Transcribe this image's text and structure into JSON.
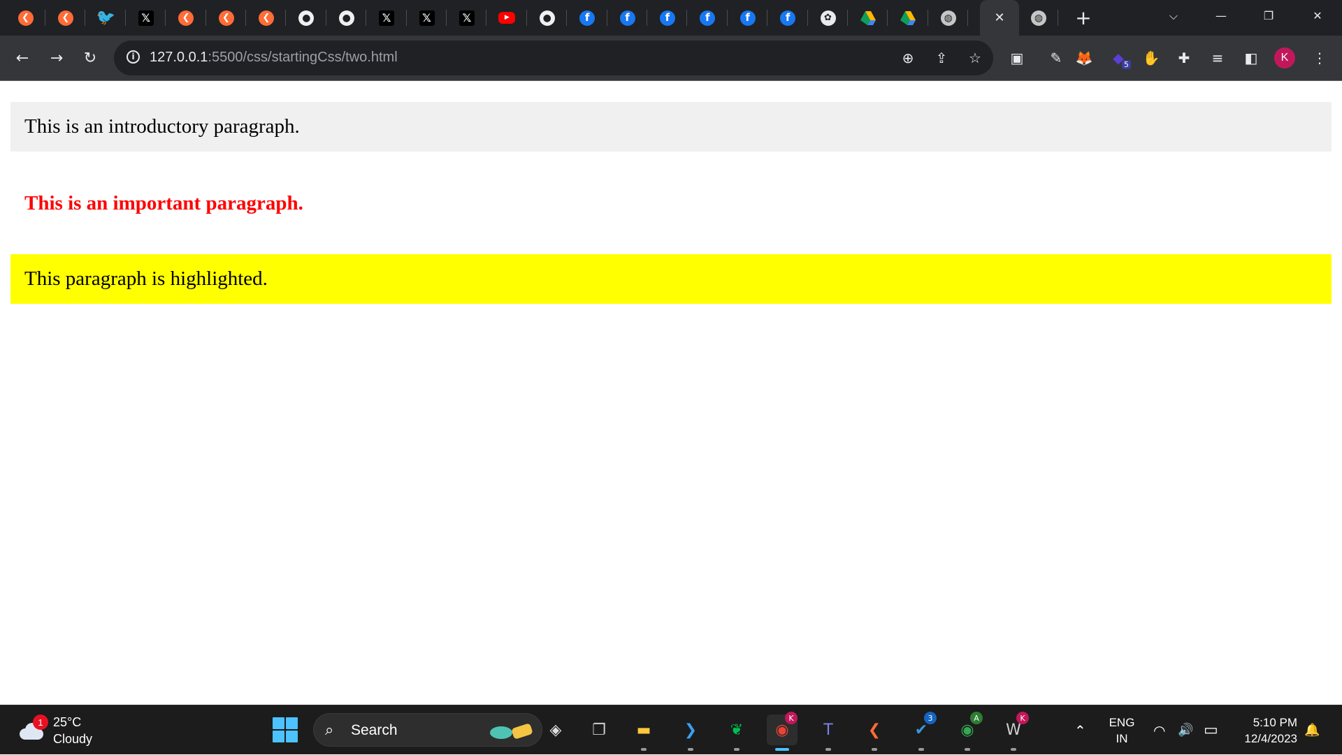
{
  "browser": {
    "tabs": [
      {
        "icon": "postman-icon",
        "cls": "postman",
        "glyph": "❮"
      },
      {
        "icon": "postman-icon",
        "cls": "postman",
        "glyph": "❮"
      },
      {
        "icon": "twitter-bird-icon",
        "cls": "twitter",
        "glyph": "🐦"
      },
      {
        "icon": "x-logo-icon",
        "cls": "x",
        "glyph": "𝕏"
      },
      {
        "icon": "postman-icon",
        "cls": "postman",
        "glyph": "❮"
      },
      {
        "icon": "postman-icon",
        "cls": "postman",
        "glyph": "❮"
      },
      {
        "icon": "postman-icon",
        "cls": "postman",
        "glyph": "❮"
      },
      {
        "icon": "github-icon",
        "cls": "github",
        "glyph": "●"
      },
      {
        "icon": "github-icon",
        "cls": "github",
        "glyph": "●"
      },
      {
        "icon": "x-logo-icon",
        "cls": "x",
        "glyph": "𝕏"
      },
      {
        "icon": "x-logo-icon",
        "cls": "x",
        "glyph": "𝕏"
      },
      {
        "icon": "x-logo-icon",
        "cls": "x",
        "glyph": "𝕏"
      },
      {
        "icon": "youtube-icon",
        "cls": "youtube",
        "glyph": "▶"
      },
      {
        "icon": "github-icon",
        "cls": "github",
        "glyph": "●"
      },
      {
        "icon": "facebook-icon",
        "cls": "facebook",
        "glyph": "f"
      },
      {
        "icon": "facebook-icon",
        "cls": "facebook",
        "glyph": "f"
      },
      {
        "icon": "facebook-icon",
        "cls": "facebook",
        "glyph": "f"
      },
      {
        "icon": "facebook-icon",
        "cls": "facebook",
        "glyph": "f"
      },
      {
        "icon": "facebook-icon",
        "cls": "facebook",
        "glyph": "f"
      },
      {
        "icon": "facebook-icon",
        "cls": "facebook",
        "glyph": "f"
      },
      {
        "icon": "chatgpt-icon",
        "cls": "chromeish",
        "glyph": "✿"
      },
      {
        "icon": "google-drive-icon",
        "cls": "drive",
        "glyph": ""
      },
      {
        "icon": "google-drive-icon",
        "cls": "drive",
        "glyph": ""
      },
      {
        "icon": "globe-icon",
        "cls": "globe",
        "glyph": "◍"
      }
    ],
    "active_tab": {
      "close_glyph": "✕"
    },
    "after_tab": {
      "icon": "globe-icon",
      "glyph": "◍"
    },
    "new_tab_glyph": "+",
    "window_controls": {
      "tab_search": "⌵",
      "minimize": "—",
      "restore": "❐",
      "close": "✕"
    },
    "nav": {
      "back": "←",
      "forward": "→",
      "reload": "↻"
    },
    "address": {
      "host": "127.0.0.1",
      "rest": ":5500/css/startingCss/two.html",
      "info_glyph": "i",
      "zoom_glyph": "⊕",
      "share_glyph": "⇪",
      "bookmark_glyph": "☆"
    },
    "extensions": {
      "pip_glyph": "▣",
      "pen_glyph": "✎",
      "metamask_glyph": "🦊",
      "stack_glyph": "◆",
      "stack_badge": "5",
      "adblock_glyph": "✋",
      "puzzle_glyph": "✚",
      "media_glyph": "≡",
      "sidepanel_glyph": "◧",
      "menu_glyph": "⋮"
    },
    "profile_initial": "K"
  },
  "page": {
    "intro": "This is an introductory paragraph.",
    "important": "This is an important paragraph.",
    "highlighted": "This paragraph is highlighted."
  },
  "taskbar": {
    "weather": {
      "badge": "1",
      "temp": "25°C",
      "condition": "Cloudy"
    },
    "search_label": "Search",
    "apps": [
      {
        "name": "copilot-icon",
        "glyph": "◈",
        "color": "#e0e0e0",
        "badge": "",
        "badge_color": "",
        "dot": false,
        "active": false
      },
      {
        "name": "task-view-icon",
        "glyph": "❐",
        "color": "#cfcfcf",
        "badge": "",
        "badge_color": "",
        "dot": false,
        "active": false
      },
      {
        "name": "file-explorer-icon",
        "glyph": "▬",
        "color": "#ffc83d",
        "badge": "",
        "badge_color": "",
        "dot": true,
        "active": false
      },
      {
        "name": "vscode-icon",
        "glyph": "❯",
        "color": "#3aa0f3",
        "badge": "",
        "badge_color": "",
        "dot": true,
        "active": false
      },
      {
        "name": "mongodb-compass-icon",
        "glyph": "❦",
        "color": "#00c050",
        "badge": "",
        "badge_color": "",
        "dot": true,
        "active": false
      },
      {
        "name": "chrome-icon",
        "glyph": "◉",
        "color": "#ea4335",
        "badge": "K",
        "badge_color": "#c2185b",
        "dot": true,
        "active": true
      },
      {
        "name": "teams-icon",
        "glyph": "T",
        "color": "#7b83eb",
        "badge": "",
        "badge_color": "",
        "dot": true,
        "active": false
      },
      {
        "name": "postman-icon",
        "glyph": "❮",
        "color": "#ff6c37",
        "badge": "",
        "badge_color": "",
        "dot": true,
        "active": false
      },
      {
        "name": "todo-icon",
        "glyph": "✔",
        "color": "#3a96dd",
        "badge": "3",
        "badge_color": "#1565c0",
        "dot": true,
        "active": false
      },
      {
        "name": "chrome-icon",
        "glyph": "◉",
        "color": "#34a853",
        "badge": "A",
        "badge_color": "#2e7d32",
        "dot": true,
        "active": false
      },
      {
        "name": "wordpad-icon",
        "glyph": "W",
        "color": "#d0d0d0",
        "badge": "K",
        "badge_color": "#c2185b",
        "dot": true,
        "active": false
      }
    ],
    "tray": {
      "chevron": "⌃",
      "lang_top": "ENG",
      "lang_bottom": "IN",
      "wifi": "◠",
      "volume": "🔊",
      "battery": "▭",
      "time": "5:10 PM",
      "date": "12/4/2023",
      "bell": "🔔"
    }
  }
}
